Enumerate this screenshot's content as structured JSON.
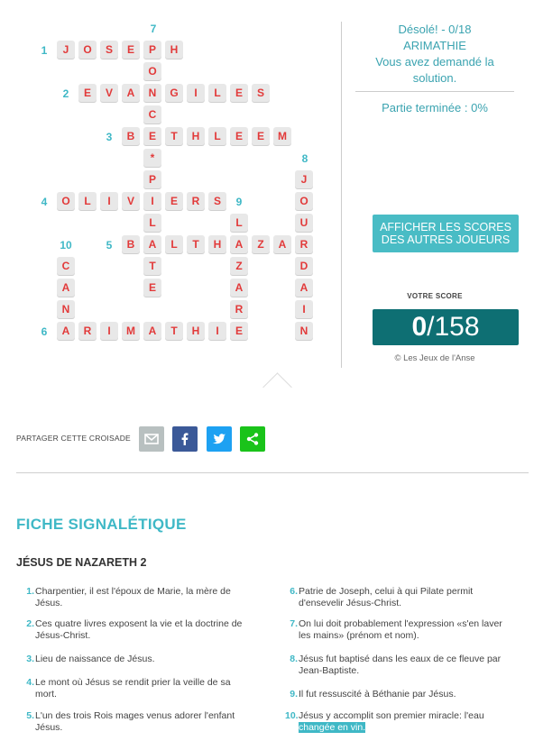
{
  "crossword": {
    "numbers": [
      "7",
      "1",
      "2",
      "3",
      "8",
      "4",
      "9",
      "10",
      "5",
      "6"
    ],
    "words": {
      "joseph": [
        "J",
        "O",
        "S",
        "E",
        "P",
        "H"
      ],
      "evangiles": [
        "E",
        "V",
        "A",
        "N",
        "G",
        "I",
        "L",
        "E",
        "S"
      ],
      "bethleem": [
        "B",
        "E",
        "T",
        "H",
        "L",
        "E",
        "E",
        "M"
      ],
      "oliviers": [
        "O",
        "L",
        "I",
        "V",
        "I",
        "E",
        "R",
        "S"
      ],
      "balthazar": [
        "B",
        "A",
        "L",
        "T",
        "H",
        "A",
        "Z",
        "A",
        "R"
      ],
      "arimathie": [
        "A",
        "R",
        "I",
        "M",
        "A",
        "T",
        "H",
        "I",
        "E"
      ],
      "ponce_pilate_extra": [
        "O",
        "C",
        "*",
        "P",
        "L",
        "T",
        "E"
      ],
      "jourdain_extra": [
        "J",
        "O",
        "U",
        "D",
        "A",
        "I",
        "N"
      ],
      "lazare_extra": [
        "L",
        "Z",
        "A",
        "R"
      ],
      "cana_extra": [
        "C",
        "A",
        "N"
      ]
    }
  },
  "side": {
    "message_line1": "Désolé! - 0/18",
    "message_line2": "ARIMATHIE",
    "message_line3": "Vous avez demandé la",
    "message_line4": "solution.",
    "progress": "Partie terminée : 0%",
    "scores_button": "AFFICHER LES SCORES DES AUTRES JOUEURS",
    "score_label": "VOTRE SCORE",
    "score_value": "0",
    "score_total": "/158",
    "copyright": "© Les Jeux de l'Anse"
  },
  "share": {
    "label": "PARTAGER CETTE CROISADE"
  },
  "fiche": {
    "title": "FICHE SIGNALÉTIQUE",
    "subtitle": "JÉSUS DE NAZARETH 2",
    "clues_left": [
      {
        "n": "1.",
        "text": "Charpentier, il est l'époux de Marie, la mère de Jésus."
      },
      {
        "n": "2.",
        "text": "Ces quatre livres exposent la vie et la doctrine de Jésus-Christ."
      },
      {
        "n": "3.",
        "text": "Lieu de naissance de Jésus."
      },
      {
        "n": "4.",
        "text": "Le mont où Jésus se rendit prier la veille de sa mort."
      },
      {
        "n": "5.",
        "text": "L'un des trois Rois mages venus adorer l'enfant Jésus."
      }
    ],
    "clues_right": [
      {
        "n": "6.",
        "text": "Patrie de Joseph, celui à qui Pilate permit d'ensevelir Jésus-Christ."
      },
      {
        "n": "7.",
        "text": "On lui doit probablement l'expression «s'en laver les mains» (prénom et nom)."
      },
      {
        "n": "8.",
        "text": "Jésus fut baptisé dans les eaux de ce fleuve par Jean-Baptiste."
      },
      {
        "n": "9.",
        "text": "Il fut ressuscité à Béthanie par Jésus."
      },
      {
        "n": "10.",
        "text_a": "Jésus y accomplit son premier miracle: l'eau ",
        "text_b": "changée en vin."
      }
    ]
  }
}
